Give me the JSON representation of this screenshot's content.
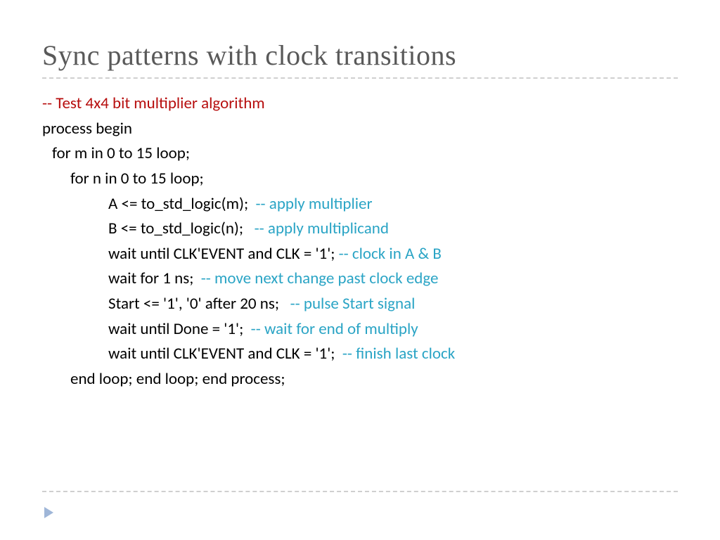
{
  "title": "Sync patterns with clock transitions",
  "lines": {
    "l0": "-- Test 4x4 bit multiplier algorithm",
    "l1": "process begin",
    "l2": "for m in 0 to 15 loop;",
    "l3": "for n in 0 to 15 loop;",
    "l4a": "A <= to_std_logic(m);  ",
    "l4b": "-- apply multiplier",
    "l5a": "B <= to_std_logic(n);   ",
    "l5b": "-- apply multiplicand",
    "l6a": "wait until CLK'EVENT and CLK = '1'; ",
    "l6b": "-- clock in A & B",
    "l7a": "wait for 1 ns;  ",
    "l7b": "-- move next change past clock edge",
    "l8a": "Start <= '1', '0' after 20 ns;   ",
    "l8b": "-- pulse Start signal",
    "l9a": "wait until Done = '1';  ",
    "l9b": "-- wait for end of multiply",
    "l10a": "wait until CLK'EVENT and CLK = '1';  ",
    "l10b": "-- finish last clock",
    "l11": "end loop; end loop; end process;"
  }
}
